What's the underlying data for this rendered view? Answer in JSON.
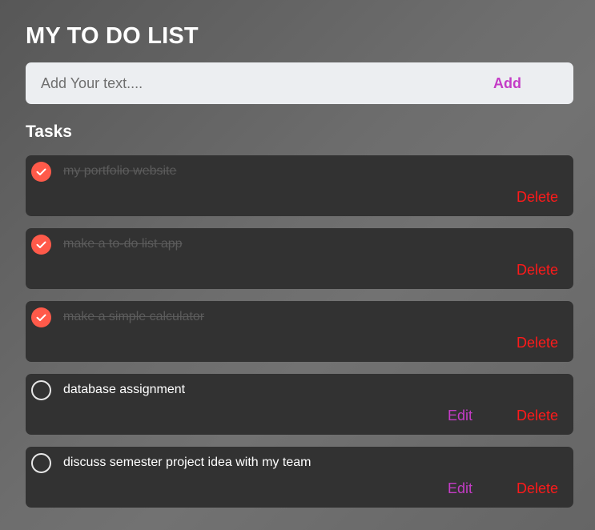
{
  "app": {
    "title": "MY TO DO LIST"
  },
  "input": {
    "placeholder": "Add Your text....",
    "value": "",
    "add_label": "Add"
  },
  "tasks_heading": "Tasks",
  "tasks": [
    {
      "text": "my portfolio website",
      "completed": true,
      "show_edit": false,
      "delete_label": "Delete"
    },
    {
      "text": "make a to-do list app",
      "completed": true,
      "show_edit": false,
      "delete_label": "Delete"
    },
    {
      "text": "make a simple calculator",
      "completed": true,
      "show_edit": false,
      "delete_label": "Delete"
    },
    {
      "text": "database assignment",
      "completed": false,
      "show_edit": true,
      "edit_label": "Edit",
      "delete_label": "Delete"
    },
    {
      "text": "discuss semester project idea with my team",
      "completed": false,
      "show_edit": true,
      "edit_label": "Edit",
      "delete_label": "Delete"
    }
  ],
  "colors": {
    "accent": "#c43cc6",
    "delete": "#ff1a1a",
    "check_done": "#ff5a4a",
    "card_bg": "#323232"
  },
  "icons": {
    "check_done": "check-circle-filled-icon",
    "check_todo": "circle-outline-icon"
  }
}
